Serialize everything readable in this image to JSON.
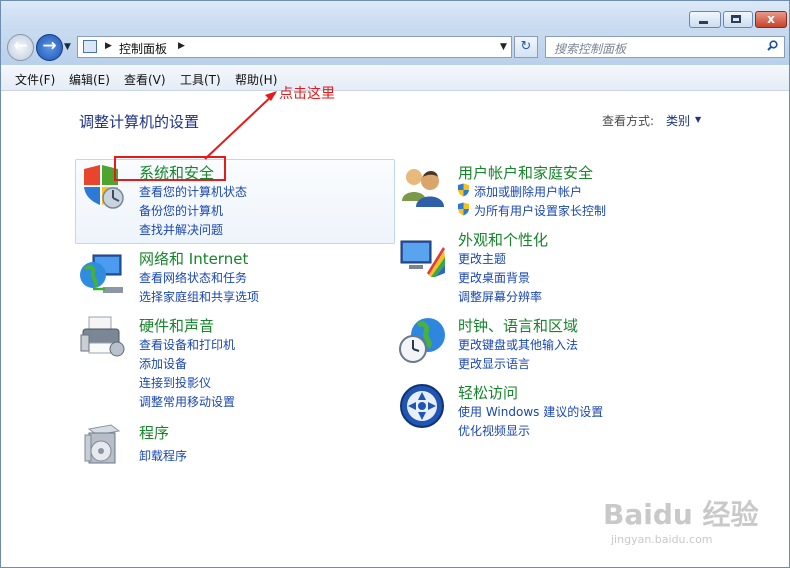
{
  "window": {
    "close_glyph": "x"
  },
  "nav": {
    "address_crumb": "控制面板",
    "search_placeholder": "搜索控制面板",
    "refresh_glyph": "↻"
  },
  "menu": [
    "文件(F)",
    "编辑(E)",
    "查看(V)",
    "工具(T)",
    "帮助(H)"
  ],
  "main": {
    "title": "调整计算机的设置",
    "view_label": "查看方式:",
    "view_value": "类别"
  },
  "categories": {
    "system": {
      "title": "系统和安全",
      "links": [
        "查看您的计算机状态",
        "备份您的计算机",
        "查找并解决问题"
      ]
    },
    "network": {
      "title": "网络和 Internet",
      "links": [
        "查看网络状态和任务",
        "选择家庭组和共享选项"
      ]
    },
    "hardware": {
      "title": "硬件和声音",
      "links": [
        "查看设备和打印机",
        "添加设备",
        "连接到投影仪",
        "调整常用移动设置"
      ]
    },
    "programs": {
      "title": "程序",
      "links": [
        "卸载程序"
      ]
    },
    "users": {
      "title": "用户帐户和家庭安全",
      "links": [
        "添加或删除用户帐户",
        "为所有用户设置家长控制"
      ]
    },
    "appearance": {
      "title": "外观和个性化",
      "links": [
        "更改主题",
        "更改桌面背景",
        "调整屏幕分辨率"
      ]
    },
    "clock": {
      "title": "时钟、语言和区域",
      "links": [
        "更改键盘或其他输入法",
        "更改显示语言"
      ]
    },
    "ease": {
      "title": "轻松访问",
      "links": [
        "使用 Windows 建议的设置",
        "优化视频显示"
      ]
    }
  },
  "annotation": {
    "text": "点击这里",
    "color": "#e31b1b"
  },
  "watermark": {
    "logo_text": "Baidu 经验",
    "url": "jingyan.baidu.com"
  },
  "colors": {
    "title_green": "#16852a",
    "link_blue": "#1a47b0",
    "heading_blue": "#1e3287"
  }
}
